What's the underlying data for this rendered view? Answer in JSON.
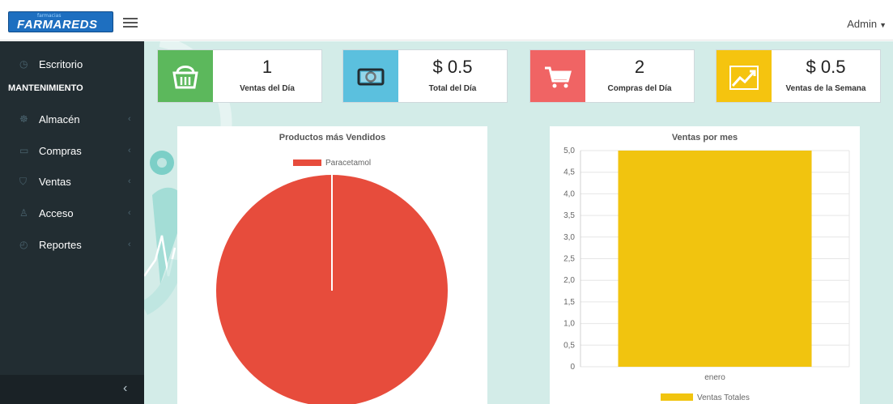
{
  "header": {
    "logo_small": "farmacias",
    "logo_text": "FARMAREDS",
    "user_label": "Admin"
  },
  "sidebar": {
    "items": [
      {
        "label": "Escritorio",
        "icon": "dashboard-icon",
        "glyph": "◷"
      },
      {
        "label": "Almacén",
        "icon": "laptop-icon",
        "glyph": "☸"
      },
      {
        "label": "Compras",
        "icon": "folder-icon",
        "glyph": "▭"
      },
      {
        "label": "Ventas",
        "icon": "cart-icon",
        "glyph": "⛉"
      },
      {
        "label": "Acceso",
        "icon": "user-icon",
        "glyph": "♙"
      },
      {
        "label": "Reportes",
        "icon": "clock-icon",
        "glyph": "◴"
      }
    ],
    "section_header": "MANTENIMIENTO",
    "collapse_glyph": "‹"
  },
  "kpis": [
    {
      "value": "1",
      "caption": "Ventas del Día",
      "icon": "basket-icon",
      "color": "#5cb85c"
    },
    {
      "value": "$ 0.5",
      "caption": "Total del Día",
      "icon": "money-icon",
      "color": "#5bc0de"
    },
    {
      "value": "2",
      "caption": "Compras del Día",
      "icon": "cart-icon",
      "color": "#f06464"
    },
    {
      "value": "$ 0.5",
      "caption": "Ventas de la Semana",
      "icon": "trend-up-icon",
      "color": "#f5c40f"
    }
  ],
  "charts": {
    "pie": {
      "title": "Productos más Vendidos",
      "legend": [
        "Paracetamol"
      ]
    },
    "bar": {
      "title": "Ventas por mes",
      "legend": [
        "Ventas Totales"
      ]
    }
  },
  "chart_data": [
    {
      "type": "pie",
      "title": "Productos más Vendidos",
      "labels": [
        "Paracetamol"
      ],
      "values": [
        1
      ],
      "colors": [
        "#e74c3c"
      ],
      "legend_position": "top"
    },
    {
      "type": "bar",
      "title": "Ventas por mes",
      "categories": [
        "enero"
      ],
      "series": [
        {
          "name": "Ventas Totales",
          "values": [
            5.0
          ],
          "color": "#f1c40f"
        }
      ],
      "yticks": [
        "0",
        "0,5",
        "1,0",
        "1,5",
        "2,0",
        "2,5",
        "3,0",
        "3,5",
        "4,0",
        "4,5",
        "5,0"
      ],
      "ylim": [
        0,
        5
      ],
      "grid": true,
      "legend_position": "bottom"
    }
  ]
}
